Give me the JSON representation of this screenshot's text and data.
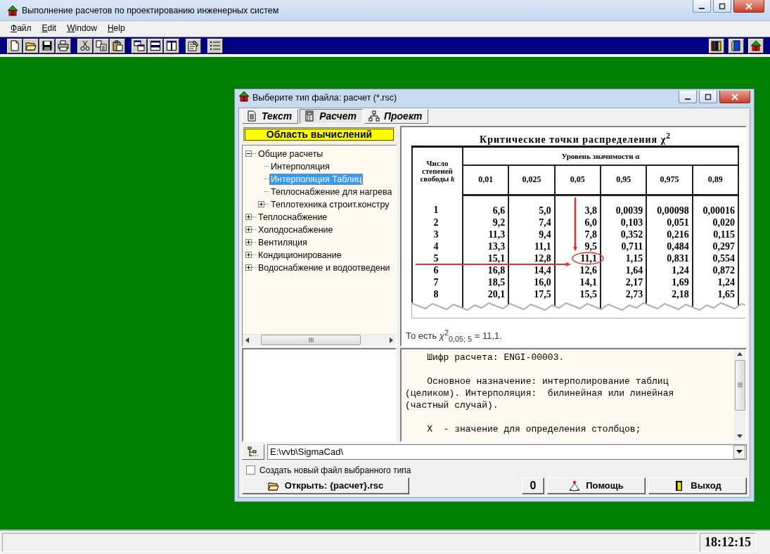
{
  "window": {
    "title": "Выполнение расчетов по проектированию инженерных систем"
  },
  "menu": [
    {
      "label": "Файл"
    },
    {
      "label": "Edit"
    },
    {
      "label": "Window"
    },
    {
      "label": "Help"
    }
  ],
  "dialog": {
    "title": "Выберите тип файла:  расчет (*.rsc)",
    "tabs": [
      {
        "label": "Текст",
        "selected": false
      },
      {
        "label": "Расчет",
        "selected": true
      },
      {
        "label": "Проект",
        "selected": false
      }
    ],
    "area_header": "Область вычислений",
    "tree": [
      {
        "label": "Общие расчеты",
        "expanded": true,
        "selected": false,
        "children": [
          {
            "label": "Интерполяция",
            "selected": false
          },
          {
            "label": "Интерполяция Таблиц",
            "selected": true
          },
          {
            "label": "Теплоснабжение для нагрева",
            "selected": false
          },
          {
            "label": "Теплотехника строит.констру",
            "expanded": false,
            "selected": false
          }
        ]
      },
      {
        "label": "Теплоснабжение",
        "expanded": false,
        "selected": false
      },
      {
        "label": "Холодоснабжение",
        "expanded": false,
        "selected": false
      },
      {
        "label": "Вентиляция",
        "expanded": false,
        "selected": false
      },
      {
        "label": "Кондиционирование",
        "expanded": false,
        "selected": false
      },
      {
        "label": "Водоснабжение и водоотведени",
        "expanded": false,
        "selected": false
      }
    ],
    "preview": {
      "title": "Критические точки распределения χ$^{2}$",
      "column_group": "Уровень значимости α",
      "columns": [
        "Число степеней свободы *k*",
        "0,01",
        "0,025",
        "0,05",
        "0,95",
        "0,975",
        "0,89"
      ],
      "rows": [
        [
          "1",
          "6,6",
          "5,0",
          "3,8",
          "0,0039",
          "0,00098",
          "0,00016"
        ],
        [
          "2",
          "9,2",
          "7,4",
          "6,0",
          "0,103",
          "0,051",
          "0,020"
        ],
        [
          "3",
          "11,3",
          "9,4",
          "7,8",
          "0,352",
          "0,216",
          "0,115"
        ],
        [
          "4",
          "13,3",
          "11,1",
          "9,5",
          "0,711",
          "0,484",
          "0,297"
        ],
        [
          "5",
          "15,1",
          "12,8",
          "11,1",
          "1,15",
          "0,831",
          "0,554"
        ],
        [
          "6",
          "16,8",
          "14,4",
          "12,6",
          "1,64",
          "1,24",
          "0,872"
        ],
        [
          "7",
          "18,5",
          "16,0",
          "14,1",
          "2,17",
          "1,69",
          "1,24"
        ],
        [
          "8",
          "20,1",
          "17,5",
          "15,5",
          "2,73",
          "2,18",
          "1,65"
        ]
      ],
      "caption": "То есть *χ*$^{2}$$_{0,05; 5}$ = 11,1."
    },
    "description": [
      "Шифр расчета: ENGI-00003.",
      "Основное назначение: интерполирование таблиц (целиком). Интерполяция:  билинейная или линейная (частный случай).",
      "X  - значение для определения столбцов;"
    ],
    "path": {
      "value": "E:\\vvb\\SigmaCad\\"
    },
    "create_new": {
      "label": "Создать новый файл выбранного типа",
      "checked": false
    },
    "buttons": [
      {
        "kind": "open",
        "label": "Открыть:  {расчет}.rsc"
      },
      {
        "kind": "counter",
        "label": "0"
      },
      {
        "kind": "help",
        "label": "Помощь"
      },
      {
        "kind": "exit",
        "label": "Выход"
      }
    ]
  },
  "status_bar": {
    "time": "18:12:15"
  }
}
